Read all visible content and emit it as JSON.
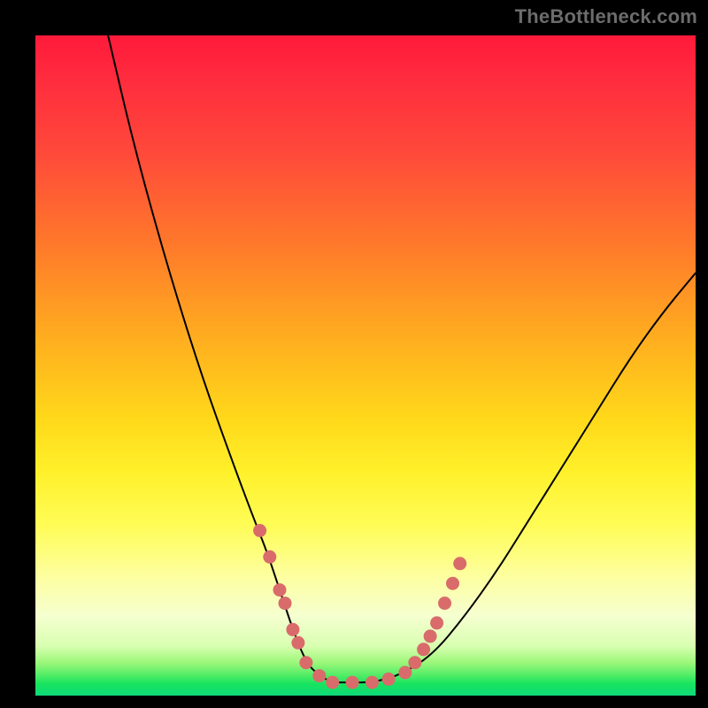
{
  "watermark": "TheBottleneck.com",
  "colors": {
    "background_frame": "#000000",
    "gradient_top": "#ff1a3a",
    "gradient_bottom": "#0ed87a",
    "curve": "#000000",
    "dots": "#d96b6b"
  },
  "chart_data": {
    "type": "line",
    "title": "",
    "xlabel": "",
    "ylabel": "",
    "xlim": [
      0,
      100
    ],
    "ylim": [
      0,
      100
    ],
    "grid": false,
    "legend": false,
    "comment": "No axes or ticks are rendered. x is horizontal position (0=left edge of plot, 100=right). y is vertical position (0=bottom green band, 100=top red). Curve is a V-shape with a flat bottom; left arm steeper than right.",
    "series": [
      {
        "name": "bottleneck-curve",
        "x": [
          11,
          15,
          20,
          25,
          30,
          33,
          35,
          37,
          39,
          41,
          43,
          45,
          48,
          51,
          55,
          60,
          65,
          70,
          75,
          80,
          85,
          90,
          95,
          100
        ],
        "y": [
          100,
          83,
          65,
          49,
          35,
          27,
          22,
          16,
          10,
          5,
          3,
          2,
          2,
          2,
          3,
          6,
          12,
          19,
          27,
          35,
          43,
          51,
          58,
          64
        ]
      }
    ],
    "dots": {
      "name": "highlight-dots",
      "comment": "Pink dots clustered on lower portions of both arms and along flat bottom.",
      "x": [
        34,
        35.5,
        37,
        37.8,
        39,
        39.8,
        41,
        43,
        45,
        48,
        51,
        53.5,
        56,
        57.5,
        58.8,
        59.8,
        60.8,
        62,
        63.2,
        64.3
      ],
      "y": [
        25,
        21,
        16,
        14,
        10,
        8,
        5,
        3,
        2,
        2,
        2,
        2.5,
        3.5,
        5,
        7,
        9,
        11,
        14,
        17,
        20
      ]
    }
  }
}
